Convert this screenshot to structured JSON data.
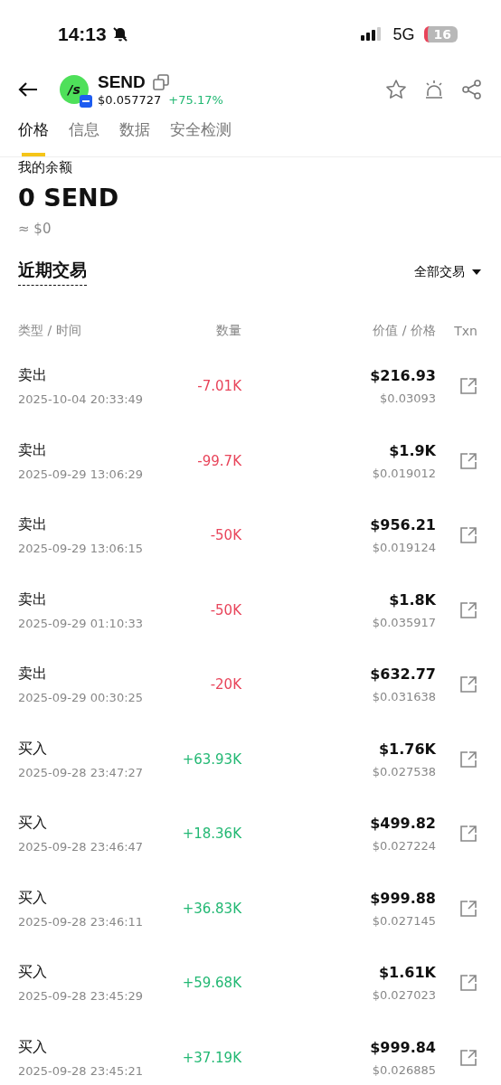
{
  "status_bar": {
    "time": "14:13",
    "network": "5G",
    "battery": "16"
  },
  "token": {
    "symbol": "SEND",
    "logo": "/s",
    "price": "$0.057727",
    "change": "+75.17%"
  },
  "tabs": [
    {
      "label": "价格",
      "selected": true
    },
    {
      "label": "信息",
      "selected": false
    },
    {
      "label": "数据",
      "selected": false
    },
    {
      "label": "安全检测",
      "selected": false
    }
  ],
  "balance": {
    "label": "我的余额",
    "amount": "0 SEND",
    "usd": "≈ $0"
  },
  "trades_section": {
    "title": "近期交易",
    "filter": "全部交易"
  },
  "columns": [
    "类型 / 时间",
    "数量",
    "价值 / 价格",
    "Txn"
  ],
  "trades": [
    {
      "kind": "sell",
      "type": "卖出",
      "time": "2025-10-04 20:33:49",
      "amount": "-7.01K",
      "value": "$216.93",
      "price": "$0.03093"
    },
    {
      "kind": "sell",
      "type": "卖出",
      "time": "2025-09-29 13:06:29",
      "amount": "-99.7K",
      "value": "$1.9K",
      "price": "$0.019012"
    },
    {
      "kind": "sell",
      "type": "卖出",
      "time": "2025-09-29 13:06:15",
      "amount": "-50K",
      "value": "$956.21",
      "price": "$0.019124"
    },
    {
      "kind": "sell",
      "type": "卖出",
      "time": "2025-09-29 01:10:33",
      "amount": "-50K",
      "value": "$1.8K",
      "price": "$0.035917"
    },
    {
      "kind": "sell",
      "type": "卖出",
      "time": "2025-09-29 00:30:25",
      "amount": "-20K",
      "value": "$632.77",
      "price": "$0.031638"
    },
    {
      "kind": "buy",
      "type": "买入",
      "time": "2025-09-28 23:47:27",
      "amount": "+63.93K",
      "value": "$1.76K",
      "price": "$0.027538"
    },
    {
      "kind": "buy",
      "type": "买入",
      "time": "2025-09-28 23:46:47",
      "amount": "+18.36K",
      "value": "$499.82",
      "price": "$0.027224"
    },
    {
      "kind": "buy",
      "type": "买入",
      "time": "2025-09-28 23:46:11",
      "amount": "+36.83K",
      "value": "$999.88",
      "price": "$0.027145"
    },
    {
      "kind": "buy",
      "type": "买入",
      "time": "2025-09-28 23:45:29",
      "amount": "+59.68K",
      "value": "$1.61K",
      "price": "$0.027023"
    },
    {
      "kind": "buy",
      "type": "买入",
      "time": "2025-09-28 23:45:21",
      "amount": "+37.19K",
      "value": "$999.84",
      "price": "$0.026885"
    }
  ]
}
